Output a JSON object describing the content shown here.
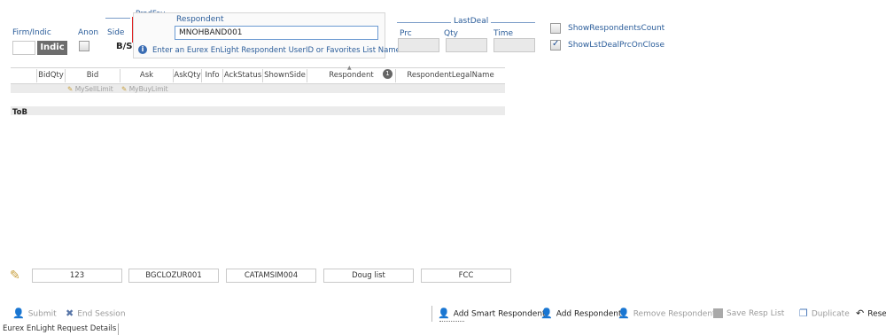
{
  "filters": {
    "firm_indic_label": "Firm/Indic",
    "indic_value": "Indic",
    "anon_label": "Anon",
    "side_label": "Side",
    "side_value": "B/S",
    "prodfav_label": "ProdFav",
    "respondent_label": "Respondent",
    "respondent_value": "MNOHBAND001",
    "tooltip": "Enter an Eurex EnLight Respondent UserID or Favorites List Name."
  },
  "last_deal": {
    "title": "LastDeal",
    "prc_label": "Prc",
    "qty_label": "Qty",
    "time_label": "Time"
  },
  "options": {
    "show_respondents_count": "ShowRespondentsCount",
    "show_lst_deal": "ShowLstDealPrcOnClose"
  },
  "table": {
    "headers": [
      "BidQty",
      "Bid",
      "Ask",
      "AskQty",
      "Info",
      "AckStatus",
      "ShownSide",
      "Respondent",
      "RespondentLegalName"
    ],
    "sort_indicator": "▲",
    "badge": "1",
    "my_sell_limit": "MySellLimit",
    "my_buy_limit": "MyBuyLimit",
    "tob_label": "ToB"
  },
  "favorites": [
    "123",
    "BGCLOZUR001",
    "CATAMSIM004",
    "Doug list",
    "FCC"
  ],
  "bottom": {
    "submit": "Submit",
    "end_session": "End Session",
    "add_smart_respondent": "Add Smart Respondent",
    "add_respondent": "Add Respondent",
    "remove_respondent": "Remove Respondent",
    "save_resp_list": "Save Resp List",
    "duplicate": "Duplicate",
    "reset": "Rese",
    "tab_label": "Eurex EnLight Request Details"
  },
  "colors": {
    "accent": "#2b5d9a",
    "highlight_box": "#e02020"
  }
}
